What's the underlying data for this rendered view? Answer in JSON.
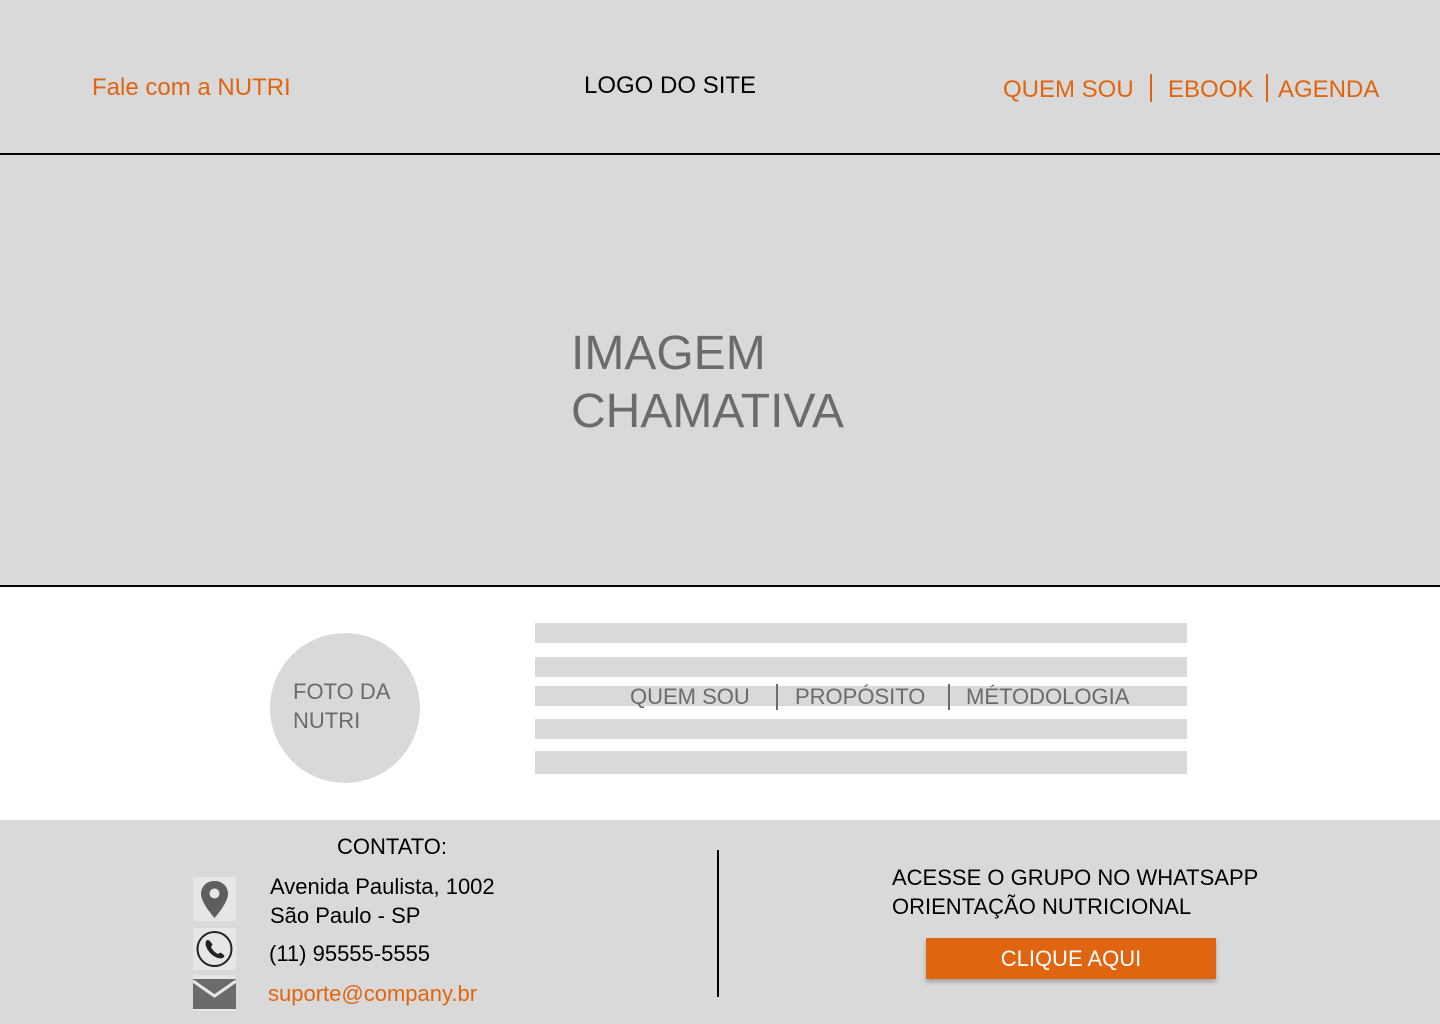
{
  "header": {
    "contact_link": "Fale com a NUTRI",
    "logo": "LOGO DO SITE",
    "nav": [
      "QUEM SOU",
      "EBOOK",
      "AGENDA"
    ]
  },
  "hero": {
    "line1": "IMAGEM",
    "line2": "CHAMATIVA"
  },
  "about": {
    "photo_line1": "FOTO DA",
    "photo_line2": "NUTRI",
    "nav": [
      "QUEM SOU",
      "PROPÓSITO",
      "MÉTODOLOGIA"
    ]
  },
  "footer": {
    "contact_title": "CONTATO:",
    "address_line1": "Avenida Paulista, 1002",
    "address_line2": "São Paulo - SP",
    "phone": "(11) 95555-5555",
    "email": "suporte@company.br",
    "whatsapp_line1": "ACESSE O GRUPO NO WHATSAPP",
    "whatsapp_line2": "ORIENTAÇÃO NUTRICIONAL",
    "cta_label": "CLIQUE AQUI"
  },
  "icons": {
    "address": "map-pin-icon",
    "phone": "phone-icon",
    "email": "mail-icon"
  },
  "colors": {
    "accent": "#e06510",
    "panel": "#d9d9d9",
    "muted_text": "#6b6b6b"
  }
}
